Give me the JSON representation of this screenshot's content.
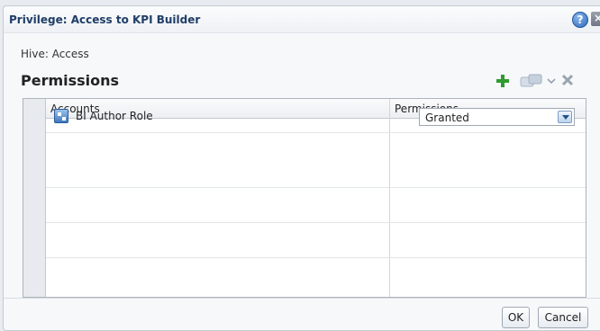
{
  "dialog": {
    "title": "Privilege: Access to KPI Builder",
    "hive_label": "Hive: Access",
    "section_title": "Permissions"
  },
  "toolbar": {
    "add_icon": "add-icon",
    "edit_icon": "edit-icon",
    "dropdown_icon": "chevron-down-icon",
    "delete_icon": "delete-icon"
  },
  "table": {
    "headers": [
      "Accounts",
      "Permissions"
    ],
    "rows": [
      {
        "account": "BI Author Role",
        "permission": "Granted",
        "icon": "role-icon"
      }
    ]
  },
  "footer": {
    "ok_label": "OK",
    "cancel_label": "Cancel"
  },
  "colors": {
    "title": "#1f3d66",
    "add_icon": "#2f9a2f"
  }
}
